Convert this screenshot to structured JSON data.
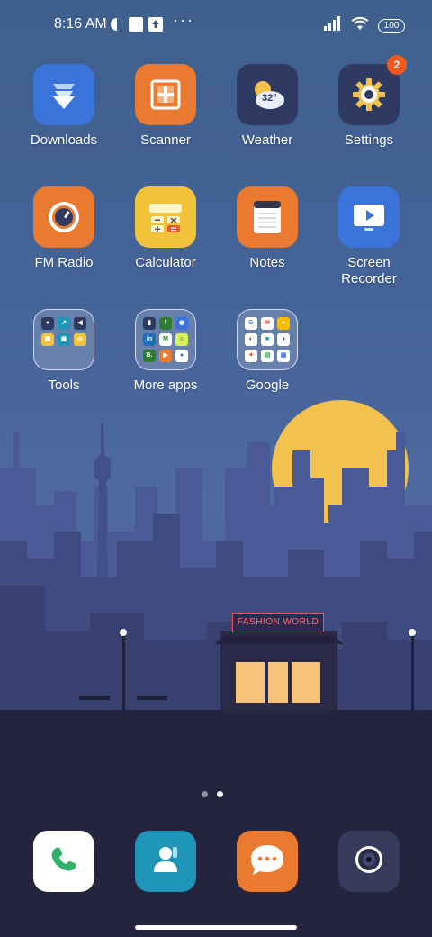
{
  "status_bar": {
    "time": "8:16 AM",
    "battery": "100",
    "more": "···"
  },
  "wallpaper": {
    "sign_text": "FASHION WORLD"
  },
  "apps": [
    {
      "label": "Downloads",
      "icon": "download-icon",
      "color": "#3a73d9"
    },
    {
      "label": "Scanner",
      "icon": "scanner-icon",
      "color": "#ea7a2f"
    },
    {
      "label": "Weather",
      "icon": "weather-icon",
      "color": "#2f3a63",
      "temp": "32°"
    },
    {
      "label": "Settings",
      "icon": "gear-icon",
      "color": "#2f3a63",
      "badge": "2"
    },
    {
      "label": "FM Radio",
      "icon": "radio-icon",
      "color": "#ea7a2f"
    },
    {
      "label": "Calculator",
      "icon": "calculator-icon",
      "color": "#f2c33a"
    },
    {
      "label": "Notes",
      "icon": "notes-icon",
      "color": "#ea7a2f"
    },
    {
      "label": "Screen Recorder",
      "icon": "screen-recorder-icon",
      "color": "#3a73d9"
    }
  ],
  "folders": [
    {
      "label": "Tools"
    },
    {
      "label": "More apps"
    },
    {
      "label": "Google"
    }
  ],
  "dock": [
    {
      "name": "phone",
      "icon": "phone-icon",
      "color": "#ffffff"
    },
    {
      "name": "contacts",
      "icon": "contacts-icon",
      "color": "#1f95b8"
    },
    {
      "name": "messaging",
      "icon": "messaging-icon",
      "color": "#ea7a2f"
    },
    {
      "name": "camera",
      "icon": "camera-icon",
      "color": "#363a5b"
    }
  ],
  "page_indicator": {
    "pages": 2,
    "current": 2
  }
}
